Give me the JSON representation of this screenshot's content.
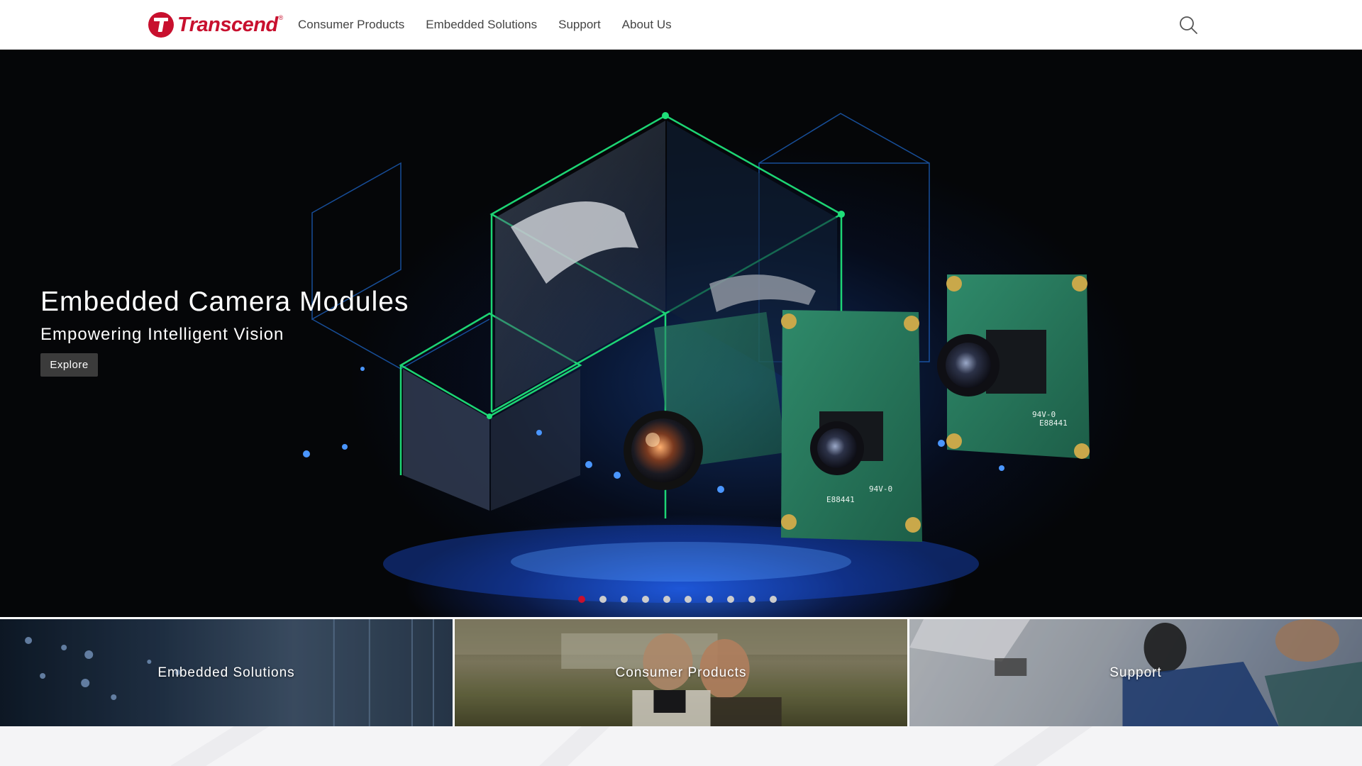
{
  "header": {
    "logo_text": "Transcend",
    "logo_reg": "®",
    "nav": [
      {
        "label": "Consumer Products"
      },
      {
        "label": "Embedded Solutions"
      },
      {
        "label": "Support"
      },
      {
        "label": "About Us"
      }
    ],
    "search_icon": "search-icon"
  },
  "hero": {
    "title": "Embedded Camera Modules",
    "subtitle": "Empowering Intelligent Vision",
    "button_label": "Explore",
    "slide_count": 10,
    "active_slide": 1
  },
  "tiles": [
    {
      "label": "Embedded Solutions"
    },
    {
      "label": "Consumer Products"
    },
    {
      "label": "Support"
    }
  ],
  "colors": {
    "brand": "#c8102e",
    "active_dot": "#c8102e",
    "inactive_dot": "#cccccc",
    "hero_bg": "#050608",
    "glow_green": "#1fe07a",
    "glow_blue": "#2f7bff"
  }
}
